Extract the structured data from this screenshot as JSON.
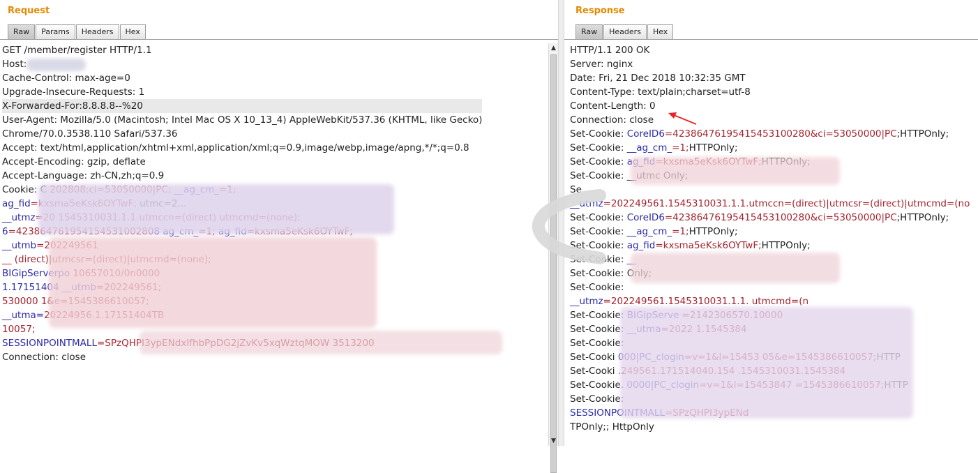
{
  "request": {
    "title": "Request",
    "tabs": [
      "Raw",
      "Params",
      "Headers",
      "Hex"
    ],
    "active_tab": "Raw",
    "lines": [
      {
        "parts": [
          {
            "t": "GET /member/register HTTP/1.1"
          }
        ]
      },
      {
        "parts": [
          {
            "t": "Host:"
          }
        ]
      },
      {
        "parts": [
          {
            "t": "Cache-Control: max-age=0"
          }
        ]
      },
      {
        "parts": [
          {
            "t": "Upgrade-Insecure-Requests: 1"
          }
        ]
      },
      {
        "parts": [
          {
            "t": "X-Forwarded-For:8.8.8.8--%20"
          }
        ],
        "highlight": true
      },
      {
        "parts": [
          {
            "t": "User-Agent: Mozilla/5.0 (Macintosh; Intel Mac OS X 10_13_4) AppleWebKit/537.36 (KHTML, like Gecko)"
          }
        ]
      },
      {
        "parts": [
          {
            "t": "Chrome/70.0.3538.110 Safari/537.36"
          }
        ]
      },
      {
        "parts": [
          {
            "t": "Accept: text/html,application/xhtml+xml,application/xml;q=0.9,image/webp,image/apng,*/*;q=0.8"
          }
        ]
      },
      {
        "parts": [
          {
            "t": "Accept-Encoding: gzip, deflate"
          }
        ]
      },
      {
        "parts": [
          {
            "t": "Accept-Language: zh-CN,zh;q=0.9"
          }
        ]
      },
      {
        "parts": [
          {
            "t": "Cookie: C"
          },
          {
            "t": "                              202808;ci=53050000|PC;",
            "c": "v"
          },
          {
            "t": "  __ag_cm_",
            "c": "k"
          },
          {
            "t": "=1;",
            "c": "v"
          }
        ]
      },
      {
        "parts": [
          {
            "t": "ag_fid",
            "c": "k"
          },
          {
            "t": "=kxsma5eKsk6OYTwF;",
            "c": "v"
          },
          {
            "t": "   utmc=2..."
          }
        ]
      },
      {
        "parts": [
          {
            "t": "__utmz",
            "c": "k"
          },
          {
            "t": "=20                1545310031.1.1.utmccn=(direct)",
            "c": "v"
          },
          {
            "t": "          utmcmd=(none);",
            "c": "v"
          }
        ]
      },
      {
        "parts": [
          {
            "t": "        6",
            "c": "k"
          },
          {
            "t": "=42386476195415453100280",
            "c": "v"
          },
          {
            "t": "8                ag_cm_",
            "c": "k"
          },
          {
            "t": "=1; ",
            "c": "v"
          },
          {
            "t": "ag_fid",
            "c": "k"
          },
          {
            "t": "=kxsma5eKsk6OYTwF;",
            "c": "v"
          }
        ]
      },
      {
        "parts": [
          {
            "t": "__utmb",
            "c": "k"
          },
          {
            "t": "=202249561",
            "c": "v"
          }
        ]
      },
      {
        "parts": [
          {
            "t": "__                                              (direct)|utmcsr=(direct)|utmcmd=(none);",
            "c": "v"
          }
        ]
      },
      {
        "parts": [
          {
            "t": "BIGipServerpo",
            "c": "k"
          },
          {
            "t": "               10657010/0n0000",
            "c": "v"
          }
        ]
      },
      {
        "parts": [
          {
            "t": "                    1.17151404                                   __utmb",
            "c": "k"
          },
          {
            "t": "=202249561;",
            "c": "v"
          }
        ]
      },
      {
        "parts": [
          {
            "t": "530000                                      1&e=1545386610057;",
            "c": "v"
          }
        ]
      },
      {
        "parts": [
          {
            "t": "__utma=",
            "c": "k"
          },
          {
            "t": "20224956.1.17151404TB",
            "c": "v"
          }
        ]
      },
      {
        "parts": [
          {
            "t": "                                                            10057;",
            "c": "v"
          }
        ]
      },
      {
        "parts": [
          {
            "t": "SESSIONPOINTMALL",
            "c": "k"
          },
          {
            "t": "=SPzQHPI3ypENdxIfhbPpDG2jZvKv5xqWztqMOW",
            "c": "v"
          },
          {
            "t": "                  3513200",
            "c": "v"
          }
        ]
      },
      {
        "parts": [
          {
            "t": "Connection: close"
          }
        ]
      }
    ]
  },
  "response": {
    "title": "Response",
    "tabs": [
      "Raw",
      "Headers",
      "Hex"
    ],
    "active_tab": "Raw",
    "lines": [
      {
        "parts": [
          {
            "t": "HTTP/1.1 200 OK"
          }
        ]
      },
      {
        "parts": [
          {
            "t": "Server: nginx"
          }
        ]
      },
      {
        "parts": [
          {
            "t": "Date: Fri, 21 Dec 2018 10:32:35 GMT"
          }
        ]
      },
      {
        "parts": [
          {
            "t": "Content-Type: text/plain;charset=utf-8"
          }
        ]
      },
      {
        "parts": [
          {
            "t": "Content-Length: 0"
          }
        ]
      },
      {
        "parts": [
          {
            "t": "Connection: close"
          }
        ]
      },
      {
        "parts": [
          {
            "t": "Set-Cookie: "
          },
          {
            "t": "CoreID6",
            "c": "k"
          },
          {
            "t": "=42386476195415453100280&ci=53050000|PC",
            "c": "v"
          },
          {
            "t": ";HTTPOnly;"
          }
        ]
      },
      {
        "parts": [
          {
            "t": "Set-Cookie: "
          },
          {
            "t": "__ag_cm_",
            "c": "k"
          },
          {
            "t": "=1;",
            "c": "v"
          },
          {
            "t": "HTTPOnly;"
          }
        ]
      },
      {
        "parts": [
          {
            "t": "Set-Cookie: "
          },
          {
            "t": "ag_fid",
            "c": "k"
          },
          {
            "t": "=kxsma5eKsk6OYTwF;",
            "c": "v"
          },
          {
            "t": "HTTPOnly;"
          }
        ]
      },
      {
        "parts": [
          {
            "t": "Set-Cookie:  __utmc"
          },
          {
            "t": "                                    Only;"
          }
        ]
      },
      {
        "parts": [
          {
            "t": "Se"
          }
        ]
      },
      {
        "parts": [
          {
            "t": "__utmz",
            "c": "k"
          },
          {
            "t": "=202249561.1545310031.1.1.utmccn=(direct)|utmcsr=(direct)|utmcmd=(no",
            "c": "v"
          }
        ]
      },
      {
        "parts": [
          {
            "t": "Set-Cookie: "
          },
          {
            "t": "CoreID6",
            "c": "k"
          },
          {
            "t": "=42386476195415453100280&ci=53050000|PC",
            "c": "v"
          },
          {
            "t": ";HTTPOnly;"
          }
        ]
      },
      {
        "parts": [
          {
            "t": "Set-Cookie: "
          },
          {
            "t": "__ag_cm_",
            "c": "k"
          },
          {
            "t": "=1;",
            "c": "v"
          },
          {
            "t": "HTTPOnly;"
          }
        ]
      },
      {
        "parts": [
          {
            "t": "Set-Cookie: "
          },
          {
            "t": "ag_fid",
            "c": "k"
          },
          {
            "t": "=kxsma5eKsk6OYTwF;",
            "c": "v"
          },
          {
            "t": "HTTPOnly;"
          }
        ]
      },
      {
        "parts": [
          {
            "t": "Set-Cookie: "
          },
          {
            "t": "__",
            "c": "k"
          }
        ]
      },
      {
        "parts": [
          {
            "t": "Set-Cookie: "
          },
          {
            "t": "                              Only;"
          }
        ]
      },
      {
        "parts": [
          {
            "t": "Set-Cookie:"
          }
        ]
      },
      {
        "parts": [
          {
            "t": "__utmz",
            "c": "k"
          },
          {
            "t": "=202249561.1545310031.1.1.",
            "c": "v"
          },
          {
            "t": "                     utmcmd=(n",
            "c": "v"
          }
        ]
      },
      {
        "parts": [
          {
            "t": "Set-Cookie: "
          },
          {
            "t": "BIGipServe",
            "c": "k"
          },
          {
            "t": "           =2142306570.10000",
            "c": "v"
          }
        ]
      },
      {
        "parts": [
          {
            "t": "Set-Cookie: "
          },
          {
            "t": "__utma",
            "c": "k"
          },
          {
            "t": "=2022",
            "c": "v"
          },
          {
            "t": "                                          1.1545384",
            "c": "v"
          }
        ]
      },
      {
        "parts": [
          {
            "t": "Set-Cookie: "
          }
        ]
      },
      {
        "parts": [
          {
            "t": "Set-Cooki"
          },
          {
            "t": "         000|PC_clogin",
            "c": "k"
          },
          {
            "t": "=v=1&l=15453      05&e=1545386610057;",
            "c": "v"
          },
          {
            "t": "HTTP"
          }
        ]
      },
      {
        "parts": [
          {
            "t": "Set-Cooki"
          },
          {
            "t": "           .249561.171514040.154",
            "c": "v"
          },
          {
            "t": "           .1545310031.1545384",
            "c": "v"
          }
        ]
      },
      {
        "parts": [
          {
            "t": "Set-Cookie."
          },
          {
            "t": "        0000|PC_clogin",
            "c": "k"
          },
          {
            "t": "=v=1&l=15453847",
            "c": "v"
          },
          {
            "t": "      =1545386610057;",
            "c": "v"
          },
          {
            "t": "HTTP"
          }
        ]
      },
      {
        "parts": [
          {
            "t": "Set-Cookie:"
          }
        ]
      },
      {
        "parts": [
          {
            "t": "SESSIONPOINTMALL",
            "c": "k"
          },
          {
            "t": "=SPzQHPI3ypENd",
            "c": "v"
          }
        ]
      },
      {
        "parts": [
          {
            "t": "TPOnly;; HttpOnly"
          }
        ]
      }
    ]
  },
  "icons": {
    "scroll_up": "▲",
    "scroll_down": "▼",
    "annotation": "red-arrow"
  },
  "colors": {
    "title": "#e58900",
    "key": "#2a2aa8",
    "value": "#a4242e",
    "arrow": "#e8262a"
  }
}
